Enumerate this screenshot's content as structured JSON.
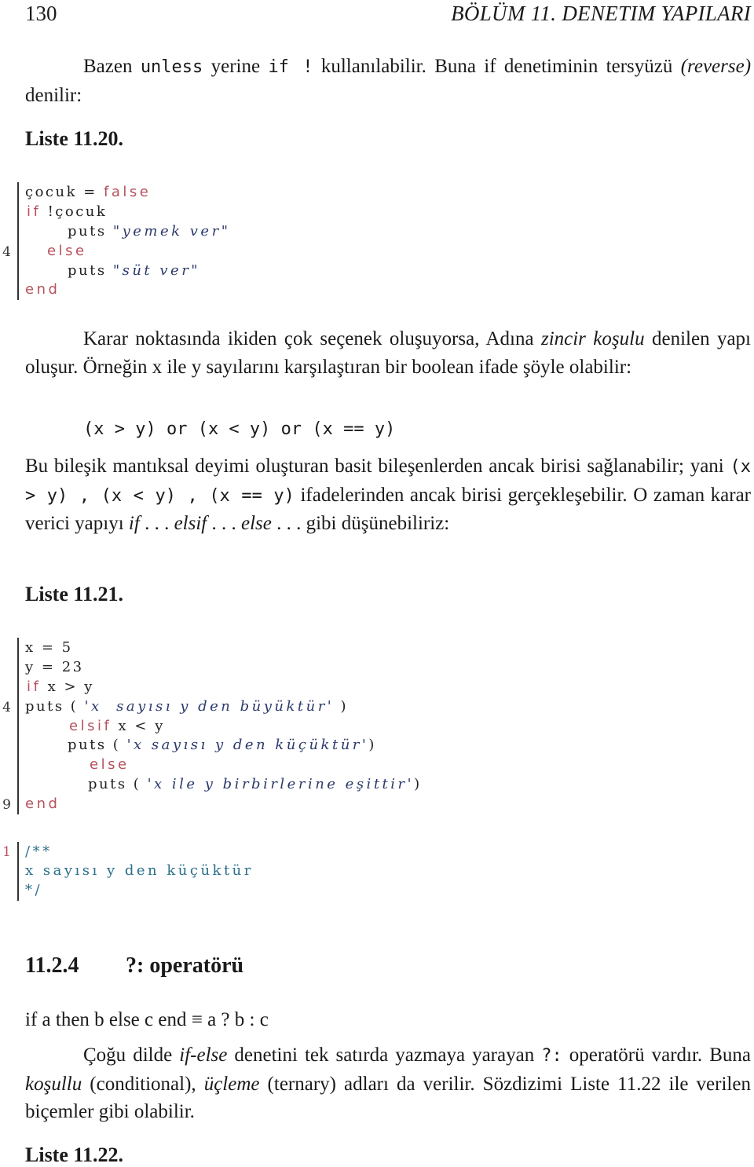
{
  "header": {
    "page_number": "130",
    "chapter_title": "BÖLÜM 11.  DENETIM YAPILARI"
  },
  "intro": {
    "t1": "Bazen ",
    "c1": "unless",
    "t2": " yerine ",
    "c2": "if !",
    "t3": " kullanılabilir. Buna if denetiminin tersyüzü ",
    "t4_italic": "(reverse)",
    "t5": " denilir:"
  },
  "listing_11_20": {
    "caption": "Liste 11.20.",
    "line_number_label": "4",
    "lines": [
      {
        "plain": "çocuk = ",
        "kw": "false"
      },
      {
        "kw": "if",
        "plain": " !çocuk"
      },
      {
        "plain": "puts ",
        "str": "\"yemek ver\""
      },
      {
        "kw": "else"
      },
      {
        "plain": "puts ",
        "str": "\"süt ver\""
      },
      {
        "kw": "end"
      }
    ]
  },
  "para_chain": {
    "t1": "Karar noktasında ikiden çok seçenek oluşuyorsa, Adına ",
    "t2_italic": "zincir koşulu",
    "t3": " denilen yapı oluşur. Örneğin x ile y sayılarını karşılaştıran bir boolean ifade şöyle olabilir:"
  },
  "expression": "(x > y) or (x < y) or (x == y)",
  "para_compound": {
    "t1": "Bu bileşik mantıksal deyimi oluşturan basit bileşenlerden ancak birisi sağlanabilir; yani ",
    "c1": "(x > y) , (x < y) , (x == y)",
    "t2": " ifadelerinden ancak birisi gerçekleşebilir. O zaman karar verici yapıyı ",
    "i1": "if",
    "d1": " . . . ",
    "i2": "elsif",
    "d2": " . . . ",
    "i3": "else",
    "t3": " . . .  gibi düşünebiliriz:"
  },
  "listing_11_21": {
    "caption": "Liste 11.21.",
    "line_numbers": [
      "4",
      "9"
    ],
    "lines": [
      {
        "plain": "x = 5"
      },
      {
        "plain": "y = 23"
      },
      {
        "kw": "if",
        "plain": " x > y"
      },
      {
        "plain": "puts ( ",
        "str": "'x  sayısı y den büyüktür'",
        "plain2": " )"
      },
      {
        "kw": "elsif",
        "plain": " x < y"
      },
      {
        "plain": "puts ( ",
        "str": "'x sayısı y den küçüktür'",
        "plain2": ")"
      },
      {
        "kw": "else"
      },
      {
        "plain": "puts ( ",
        "str": "'x ile y birbirlerine eşittir'",
        "plain2": ")"
      },
      {
        "kw": "end"
      }
    ]
  },
  "comment_listing": {
    "line_number": "1",
    "lines": [
      "/**",
      "x sayısı y den küçüktür",
      "*/"
    ]
  },
  "section": {
    "number": "11.2.4",
    "title": "?: operatörü"
  },
  "equivalence": "if a then b else c end ≡ a ? b : c",
  "para_ternary": {
    "t1": "Çoğu dilde ",
    "i1": "if-else",
    "t2": " denetini tek satırda yazmaya yarayan ",
    "c1": "?:",
    "t3": " operatörü vardır. Buna ",
    "i2": "koşullu",
    "t4": " (conditional), ",
    "i3": "üçleme",
    "t5": " (ternary) adları da verilir. Sözdizimi Liste 11.22 ile verilen biçemler gibi olabilir."
  },
  "listing_11_22": {
    "caption": "Liste 11.22."
  }
}
